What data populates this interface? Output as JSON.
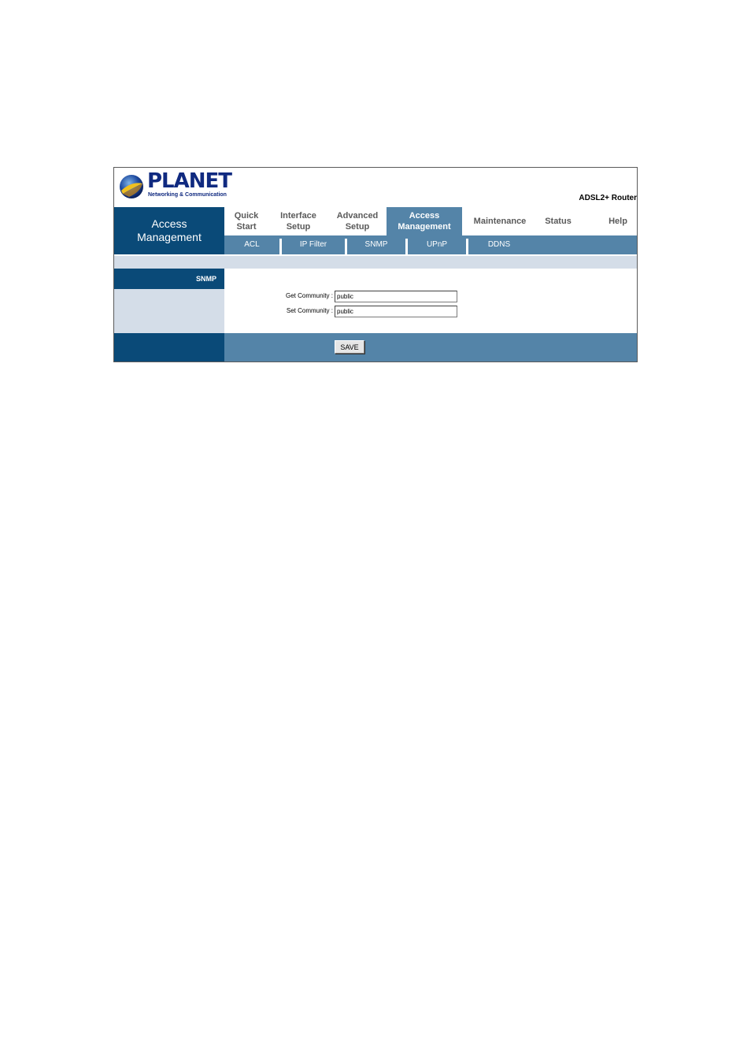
{
  "brand": {
    "name": "PLANET",
    "tagline": "Networking & Communication"
  },
  "product_name": "ADSL2+ Router",
  "section_title": "Access Management",
  "main_tabs": [
    {
      "label": "Quick\nStart",
      "active": false
    },
    {
      "label": "Interface\nSetup",
      "active": false
    },
    {
      "label": "Advanced\nSetup",
      "active": false
    },
    {
      "label": "Access\nManagement",
      "active": true
    },
    {
      "label": "Maintenance",
      "active": false
    },
    {
      "label": "Status",
      "active": false
    },
    {
      "label": "Help",
      "active": false
    }
  ],
  "sub_tabs": [
    {
      "label": "ACL"
    },
    {
      "label": "IP Filter"
    },
    {
      "label": "SNMP"
    },
    {
      "label": "UPnP"
    },
    {
      "label": "DDNS"
    }
  ],
  "side_label": "SNMP",
  "form": {
    "get_community": {
      "label": "Get Community :",
      "value": "public"
    },
    "set_community": {
      "label": "Set Community :",
      "value": "public"
    }
  },
  "save_label": "SAVE",
  "colors": {
    "dark_navy": "#0a4a78",
    "steel_blue": "#5484a8",
    "light_gray_blue": "#d4dde8",
    "brand_blue": "#102a80"
  }
}
